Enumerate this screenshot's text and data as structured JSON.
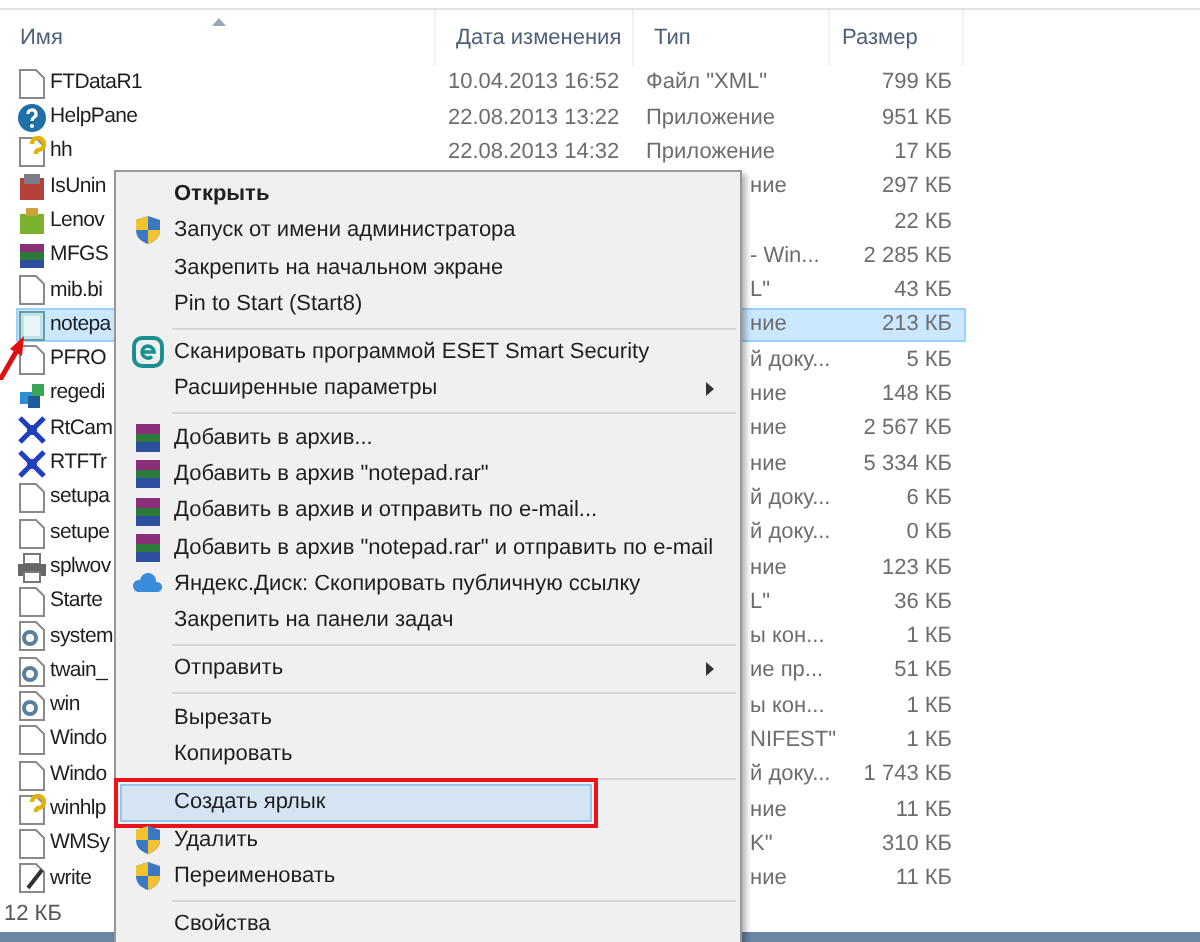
{
  "columns": [
    {
      "label": "Имя",
      "sorted": true
    },
    {
      "label": "Дата изменения",
      "sorted": false
    },
    {
      "label": "Тип",
      "sorted": false
    },
    {
      "label": "Размер",
      "sorted": false
    }
  ],
  "rows": [
    {
      "name": "FTDataR1",
      "kind": "doc",
      "date": "10.04.2013 16:52",
      "type": "Файл \"XML\"",
      "size": "799 КБ",
      "selected": false
    },
    {
      "name": "HelpPane",
      "kind": "help",
      "date": "22.08.2013 13:22",
      "type": "Приложение",
      "size": "951 КБ",
      "selected": false
    },
    {
      "name": "hh",
      "kind": "helpdoc",
      "date": "22.08.2013 14:32",
      "type": "Приложение",
      "size": "17 КБ",
      "selected": false
    },
    {
      "name": "IsUnin",
      "kind": "setup",
      "type": "ние",
      "size": "297 КБ",
      "selected": false
    },
    {
      "name": "Lenov",
      "kind": "lenovo",
      "size": "22 КБ",
      "selected": false
    },
    {
      "name": "MFGS",
      "kind": "rar",
      "type": "- Win...",
      "size": "2 285 КБ",
      "selected": false
    },
    {
      "name": "mib.bi",
      "kind": "doc",
      "type": "L\"",
      "size": "43 КБ",
      "selected": false
    },
    {
      "name": "notepa",
      "kind": "notepad",
      "type": "ние",
      "size": "213 КБ",
      "selected": true
    },
    {
      "name": "PFRO",
      "kind": "doc",
      "type": "й доку...",
      "size": "5 КБ",
      "selected": false
    },
    {
      "name": "regedi",
      "kind": "regedit",
      "type": "ние",
      "size": "148 КБ",
      "selected": false
    },
    {
      "name": "RtCam",
      "kind": "rtcam",
      "type": "ние",
      "size": "2 567 КБ",
      "selected": false
    },
    {
      "name": "RTFTr",
      "kind": "rtcam",
      "type": "ние",
      "size": "5 334 КБ",
      "selected": false
    },
    {
      "name": "setupa",
      "kind": "doc",
      "type": "й доку...",
      "size": "6 КБ",
      "selected": false
    },
    {
      "name": "setupe",
      "kind": "doc",
      "type": "й доку...",
      "size": "0 КБ",
      "selected": false
    },
    {
      "name": "splwov",
      "kind": "printer",
      "type": "ние",
      "size": "123 КБ",
      "selected": false
    },
    {
      "name": "Starte",
      "kind": "doc",
      "type": "L\"",
      "size": "36 КБ",
      "selected": false
    },
    {
      "name": "system",
      "kind": "gear",
      "type": "ы кон...",
      "size": "1 КБ",
      "selected": false
    },
    {
      "name": "twain_",
      "kind": "gear",
      "type": "ие пр...",
      "size": "51 КБ",
      "selected": false
    },
    {
      "name": "win",
      "kind": "gear",
      "type": "ы кон...",
      "size": "1 КБ",
      "selected": false
    },
    {
      "name": "Windo",
      "kind": "doc",
      "type": "NIFEST\"",
      "size": "1 КБ",
      "selected": false
    },
    {
      "name": "Windo",
      "kind": "doc",
      "type": "й доку...",
      "size": "1 743 КБ",
      "selected": false
    },
    {
      "name": "winhlp",
      "kind": "helpdoc",
      "type": "ние",
      "size": "11 КБ",
      "selected": false
    },
    {
      "name": "WMSy",
      "kind": "doc",
      "type": "K\"",
      "size": "310 КБ",
      "selected": false
    },
    {
      "name": "write",
      "kind": "write",
      "type": "ние",
      "size": "11 КБ",
      "selected": false
    }
  ],
  "status_bar": {
    "text": "12 КБ"
  },
  "context_menu": {
    "items": [
      {
        "kind": "item",
        "label": "Открыть",
        "bold": true,
        "selected": false,
        "outlined": false,
        "submenu": false
      },
      {
        "kind": "shield",
        "label": "Запуск от имени администратора",
        "bold": false,
        "selected": false,
        "outlined": false,
        "submenu": false
      },
      {
        "kind": "item",
        "label": "Закрепить на начальном экране",
        "bold": false,
        "selected": false,
        "outlined": false,
        "submenu": false
      },
      {
        "kind": "item",
        "label": "Pin to Start (Start8)",
        "bold": false,
        "selected": false,
        "outlined": false,
        "submenu": false
      },
      {
        "kind": "separator"
      },
      {
        "kind": "eset",
        "label": "Сканировать программой ESET Smart Security",
        "bold": false,
        "selected": false,
        "outlined": false,
        "submenu": false
      },
      {
        "kind": "item",
        "label": "Расширенные параметры",
        "bold": false,
        "selected": false,
        "outlined": false,
        "submenu": true
      },
      {
        "kind": "separator"
      },
      {
        "kind": "archive",
        "label": "Добавить в архив...",
        "bold": false,
        "selected": false,
        "outlined": false,
        "submenu": false
      },
      {
        "kind": "archive",
        "label": "Добавить в архив \"notepad.rar\"",
        "bold": false,
        "selected": false,
        "outlined": false,
        "submenu": false
      },
      {
        "kind": "archive",
        "label": "Добавить в архив и отправить по e-mail...",
        "bold": false,
        "selected": false,
        "outlined": false,
        "submenu": false
      },
      {
        "kind": "archive",
        "label": "Добавить в архив \"notepad.rar\" и отправить по e-mail",
        "bold": false,
        "selected": false,
        "outlined": false,
        "submenu": false
      },
      {
        "kind": "cloud",
        "label": "Яндекс.Диск: Скопировать публичную ссылку",
        "bold": false,
        "selected": false,
        "outlined": false,
        "submenu": false
      },
      {
        "kind": "item",
        "label": "Закрепить на панели задач",
        "bold": false,
        "selected": false,
        "outlined": false,
        "submenu": false
      },
      {
        "kind": "separator"
      },
      {
        "kind": "item",
        "label": "Отправить",
        "bold": false,
        "selected": false,
        "outlined": false,
        "submenu": true
      },
      {
        "kind": "separator"
      },
      {
        "kind": "item",
        "label": "Вырезать",
        "bold": false,
        "selected": false,
        "outlined": false,
        "submenu": false
      },
      {
        "kind": "item",
        "label": "Копировать",
        "bold": false,
        "selected": false,
        "outlined": false,
        "submenu": false
      },
      {
        "kind": "separator"
      },
      {
        "kind": "item",
        "label": "Создать ярлык",
        "bold": false,
        "selected": true,
        "outlined": true,
        "submenu": false
      },
      {
        "kind": "shield",
        "label": "Удалить",
        "bold": false,
        "selected": false,
        "outlined": false,
        "submenu": false
      },
      {
        "kind": "shield",
        "label": "Переименовать",
        "bold": false,
        "selected": false,
        "outlined": false,
        "submenu": false
      },
      {
        "kind": "separator"
      },
      {
        "kind": "item",
        "label": "Свойства",
        "bold": false,
        "selected": false,
        "outlined": false,
        "submenu": false
      }
    ]
  },
  "annotation": {
    "kind": "arrow"
  }
}
